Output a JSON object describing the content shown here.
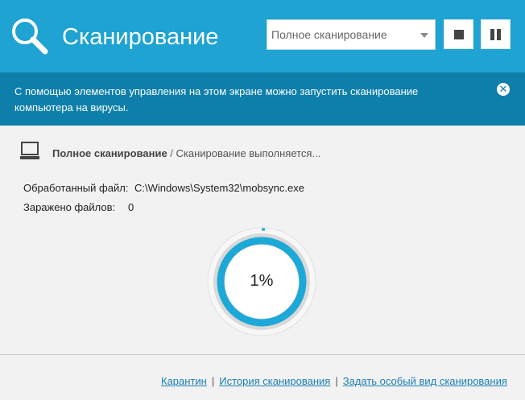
{
  "header": {
    "title": "Сканирование",
    "scan_type_selected": "Полное сканирование",
    "stop_button": "stop-icon",
    "pause_button": "pause-icon",
    "accent_color": "#1ea3d3"
  },
  "info_bar": {
    "text": "С помощью элементов управления на этом экране можно запустить сканирование компьютера на вирусы.",
    "close_icon": "close-icon",
    "color": "#0e7fab"
  },
  "scan": {
    "name": "Полное сканирование",
    "separator": " / ",
    "status": "Сканирование выполняется...",
    "processed_label": "Обработанный файл:",
    "processed_value": "C:\\Windows\\System32\\mobsync.exe",
    "infected_label": "Заражено файлов:",
    "infected_value": "0",
    "progress_text": "1%",
    "progress_value": 0.01
  },
  "footer": {
    "links": [
      "Карантин",
      "История сканирования",
      "Задать особый вид сканирования"
    ],
    "separator": "|"
  }
}
